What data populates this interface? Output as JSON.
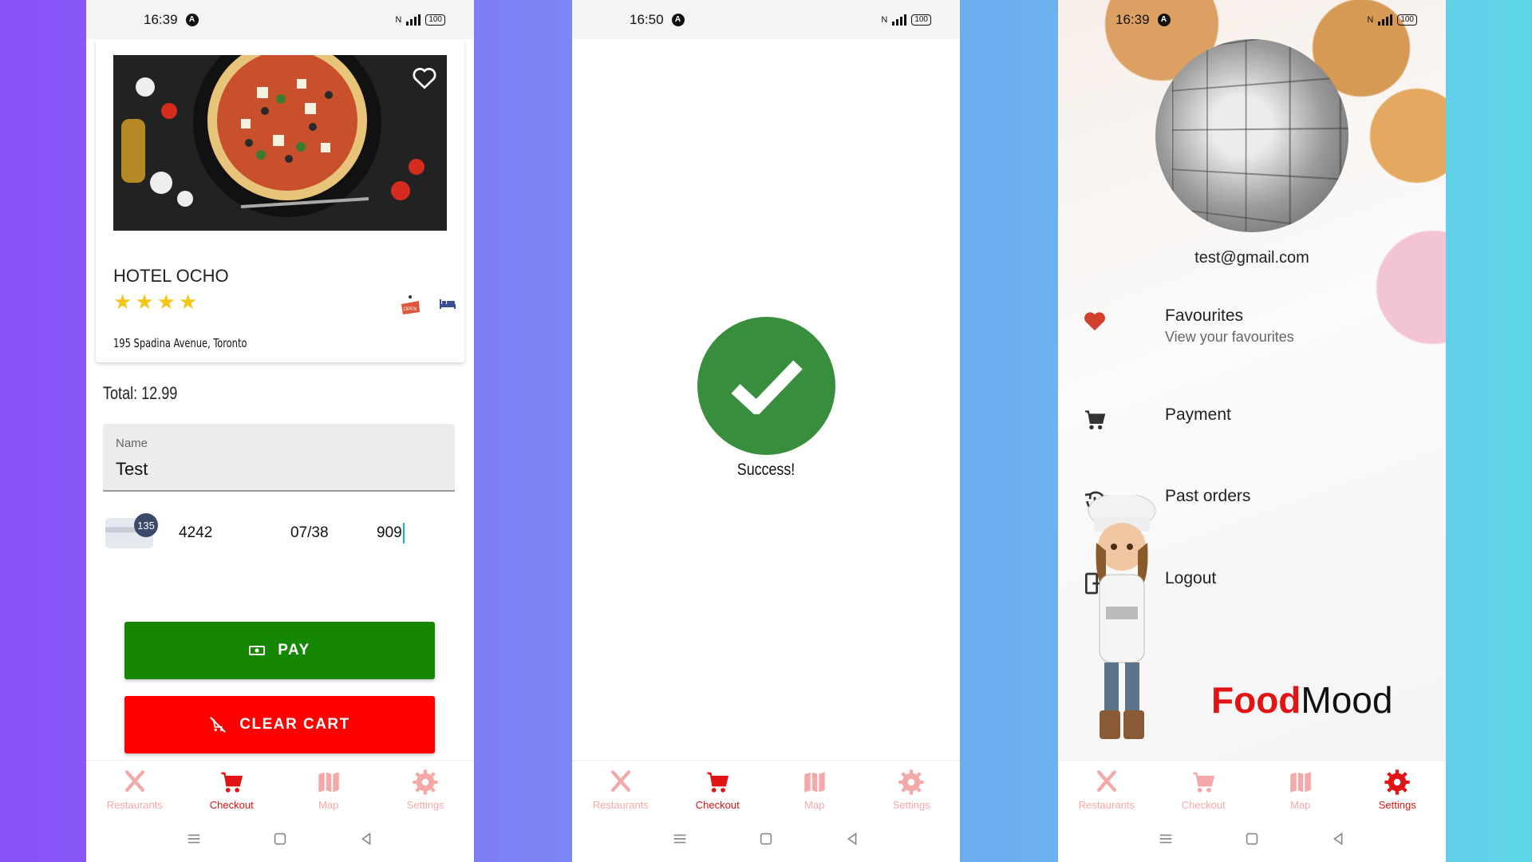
{
  "screens": [
    {
      "status": {
        "time": "16:39",
        "battery": "100"
      },
      "restaurant": {
        "name": "HOTEL OCHO",
        "rating": 4,
        "address": "195 Spadina Avenue, Toronto",
        "open_badge": "OPEN"
      },
      "total": "Total: 12.99",
      "name_field": {
        "label": "Name",
        "value": "Test"
      },
      "card": {
        "badge": "135",
        "number": "4242",
        "expiry": "07/38",
        "cvc": "909"
      },
      "pay_label": "PAY",
      "clear_label": "CLEAR CART"
    },
    {
      "status": {
        "time": "16:50",
        "battery": "100"
      },
      "message": "Success!"
    },
    {
      "status": {
        "time": "16:39",
        "battery": "100"
      },
      "email": "test@gmail.com",
      "menu": [
        {
          "title": "Favourites",
          "subtitle": "View your favourites",
          "icon": "heart-icon"
        },
        {
          "title": "Payment",
          "icon": "cart-icon"
        },
        {
          "title": "Past orders",
          "icon": "history-icon"
        },
        {
          "title": "Logout",
          "icon": "logout-icon"
        }
      ],
      "brand": {
        "part1": "Food",
        "part2": "Mood"
      }
    }
  ],
  "nav": {
    "items": [
      "Restaurants",
      "Checkout",
      "Map",
      "Settings"
    ]
  },
  "colors": {
    "accent": "#e01414",
    "inactive": "#f5a8a8",
    "pay": "#168703",
    "clear": "#ff0000",
    "success": "#388e3c"
  }
}
